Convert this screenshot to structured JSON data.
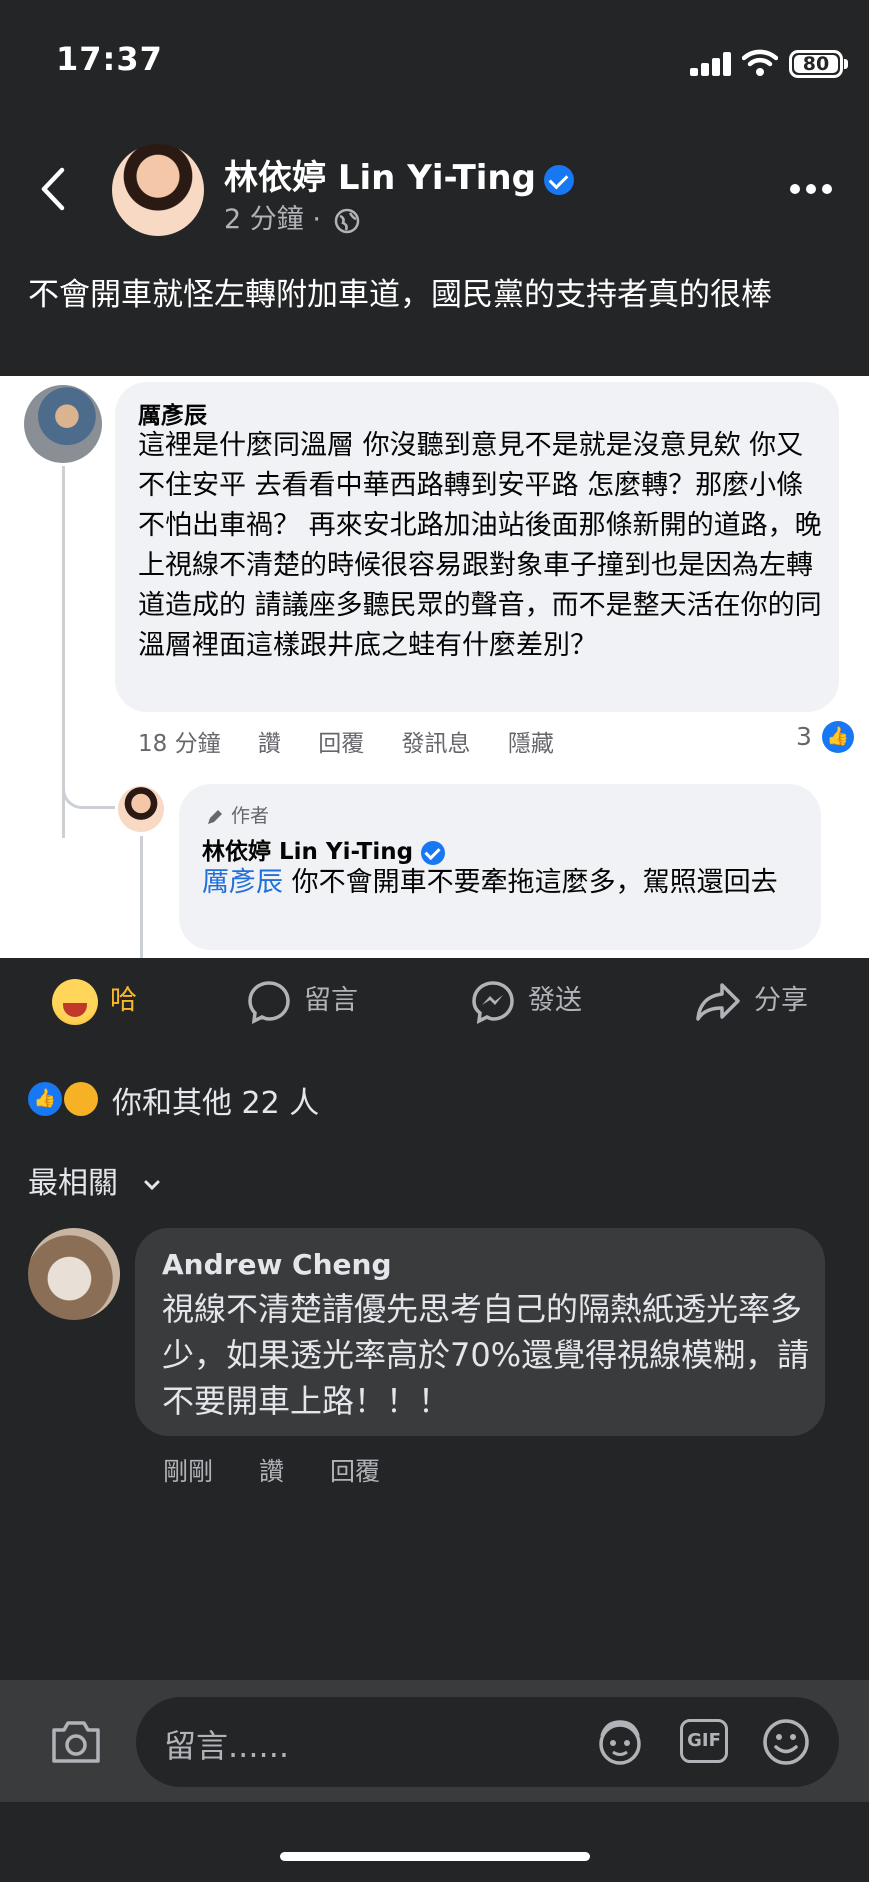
{
  "status_bar": {
    "time": "17:37",
    "battery": "80"
  },
  "post": {
    "page_name": "林依婷 Lin Yi-Ting",
    "time": "2 分鐘 ·",
    "text": "不會開車就怪左轉附加車道，國民黨的支持者真的很棒"
  },
  "screenshot_comment": {
    "name": "厲彥辰",
    "text": "這裡是什麼同溫層 你沒聽到意見不是就是沒意見欸 你又不住安平 去看看中華西路轉到安平路 怎麼轉？那麼小條不怕出車禍？ 再來安北路加油站後面那條新開的道路，晚上視線不清楚的時候很容易跟對象車子撞到也是因為左轉道造成的 請議座多聽民眾的聲音，而不是整天活在你的同溫層裡面這樣跟井底之蛙有什麼差別？",
    "meta": [
      "18 分鐘",
      "讚",
      "回覆",
      "發訊息",
      "隱藏"
    ],
    "like_count": "3",
    "reply": {
      "author_tag": "作者",
      "name": "林依婷 Lin Yi-Ting",
      "mention": "厲彥辰",
      "text": " 你不會開車不要牽拖這麼多，駕照還回去"
    }
  },
  "action_bar": {
    "haha": "哈",
    "comment": "留言",
    "send": "發送",
    "share": "分享"
  },
  "reactions": {
    "text": "你和其他 22 人"
  },
  "sort": {
    "label": "最相關"
  },
  "comment": {
    "name": "Andrew Cheng",
    "text": "視線不清楚請優先思考自己的隔熱紙透光率多少，如果透光率高於70%還覺得視線模糊，請不要開車上路！！！",
    "meta": [
      "剛剛",
      "讚",
      "回覆"
    ]
  },
  "composer": {
    "placeholder": "留言......"
  },
  "colors": {
    "accent": "#1877f2",
    "haha_label": "#f7b928",
    "background": "#242526"
  }
}
